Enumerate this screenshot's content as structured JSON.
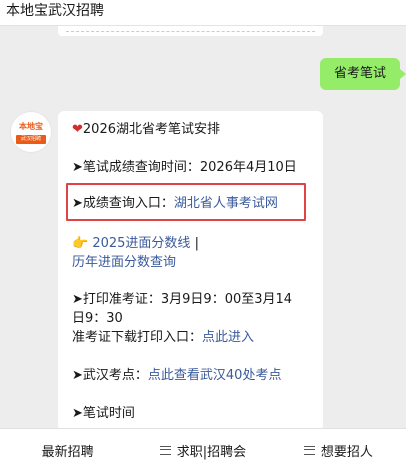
{
  "header": {
    "title": "本地宝武汉招聘"
  },
  "user_message": {
    "text": "省考笔试"
  },
  "bot": {
    "avatar_logo_top": "本地宝",
    "avatar_logo_bottom": "武汉招聘",
    "heading": "2026湖北省考笔试安排",
    "result_time": "➤笔试成绩查询时间：2026年4月10日",
    "entry_prefix": "➤成绩查询入口：",
    "entry_link": "湖北省人事考试网",
    "score_line_link": "2025进面分数线",
    "separator": "|",
    "history_link": "历年进面分数查询",
    "admit_print_1": "➤打印准考证：3月9日9：00至3月14",
    "admit_print_2": "日9：30",
    "admit_entry_prefix": "准考证下载打印入口：",
    "admit_entry_link": "点此进入",
    "venue_prefix": "➤武汉考点：",
    "venue_link": "点此查看武汉40处考点",
    "exam_time": "➤笔试时间"
  },
  "footer": {
    "tabs": [
      {
        "label": "最新招聘",
        "icon": ""
      },
      {
        "label": "求职|招聘会",
        "icon": "menu-icon"
      },
      {
        "label": "想要招人",
        "icon": "menu-icon"
      }
    ]
  },
  "colors": {
    "user_bubble": "#95ec69",
    "link": "#3a5a9b",
    "highlight_border": "#e04343"
  }
}
